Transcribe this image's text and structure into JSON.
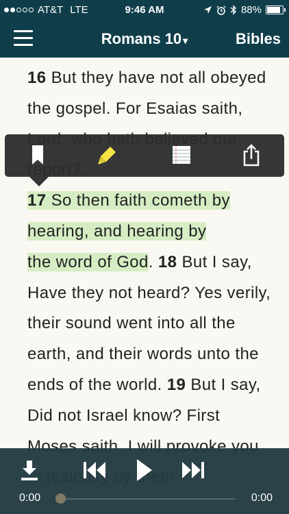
{
  "status_bar": {
    "carrier": "AT&T",
    "network": "LTE",
    "time": "9:46 AM",
    "battery": "88%",
    "battery_level": 0.88,
    "icons": [
      "location-arrow-icon",
      "alarm-icon",
      "bluetooth-icon",
      "battery-icon"
    ]
  },
  "nav": {
    "title": "Romans 10",
    "caret": "▾",
    "right_label": "Bibles",
    "menu_icon": "hamburger-menu-icon"
  },
  "verses_text": {
    "v16_num": "16",
    "v16": "But they have not all obeyed the gospel. For Esaias saith, Lord, who hath believed our report?",
    "v17_num": "17",
    "v17_line1": "So then faith cometh by",
    "v17_line2": "hearing, and hearing by",
    "v17_line3": "the word of God",
    "period": ".",
    "v18_num": "18",
    "v18": "But I say, Have they not heard? Yes verily, their sound went into all the earth, and their words unto the ends of the world.",
    "v19_num": "19",
    "v19": "But I say, Did not Israel know? First Moses saith, I will provoke you to jealousy by them"
  },
  "highlight_color": "#d6edc4",
  "popover_actions": [
    {
      "icon": "bookmark-icon"
    },
    {
      "icon": "highlighter-icon",
      "color": "#f5e33a"
    },
    {
      "icon": "notes-icon"
    },
    {
      "icon": "share-icon"
    }
  ],
  "player": {
    "icons": [
      "download-icon",
      "rewind-icon",
      "play-icon",
      "fast-forward-icon"
    ],
    "elapsed": "0:00",
    "duration": "0:00",
    "progress": 0
  }
}
